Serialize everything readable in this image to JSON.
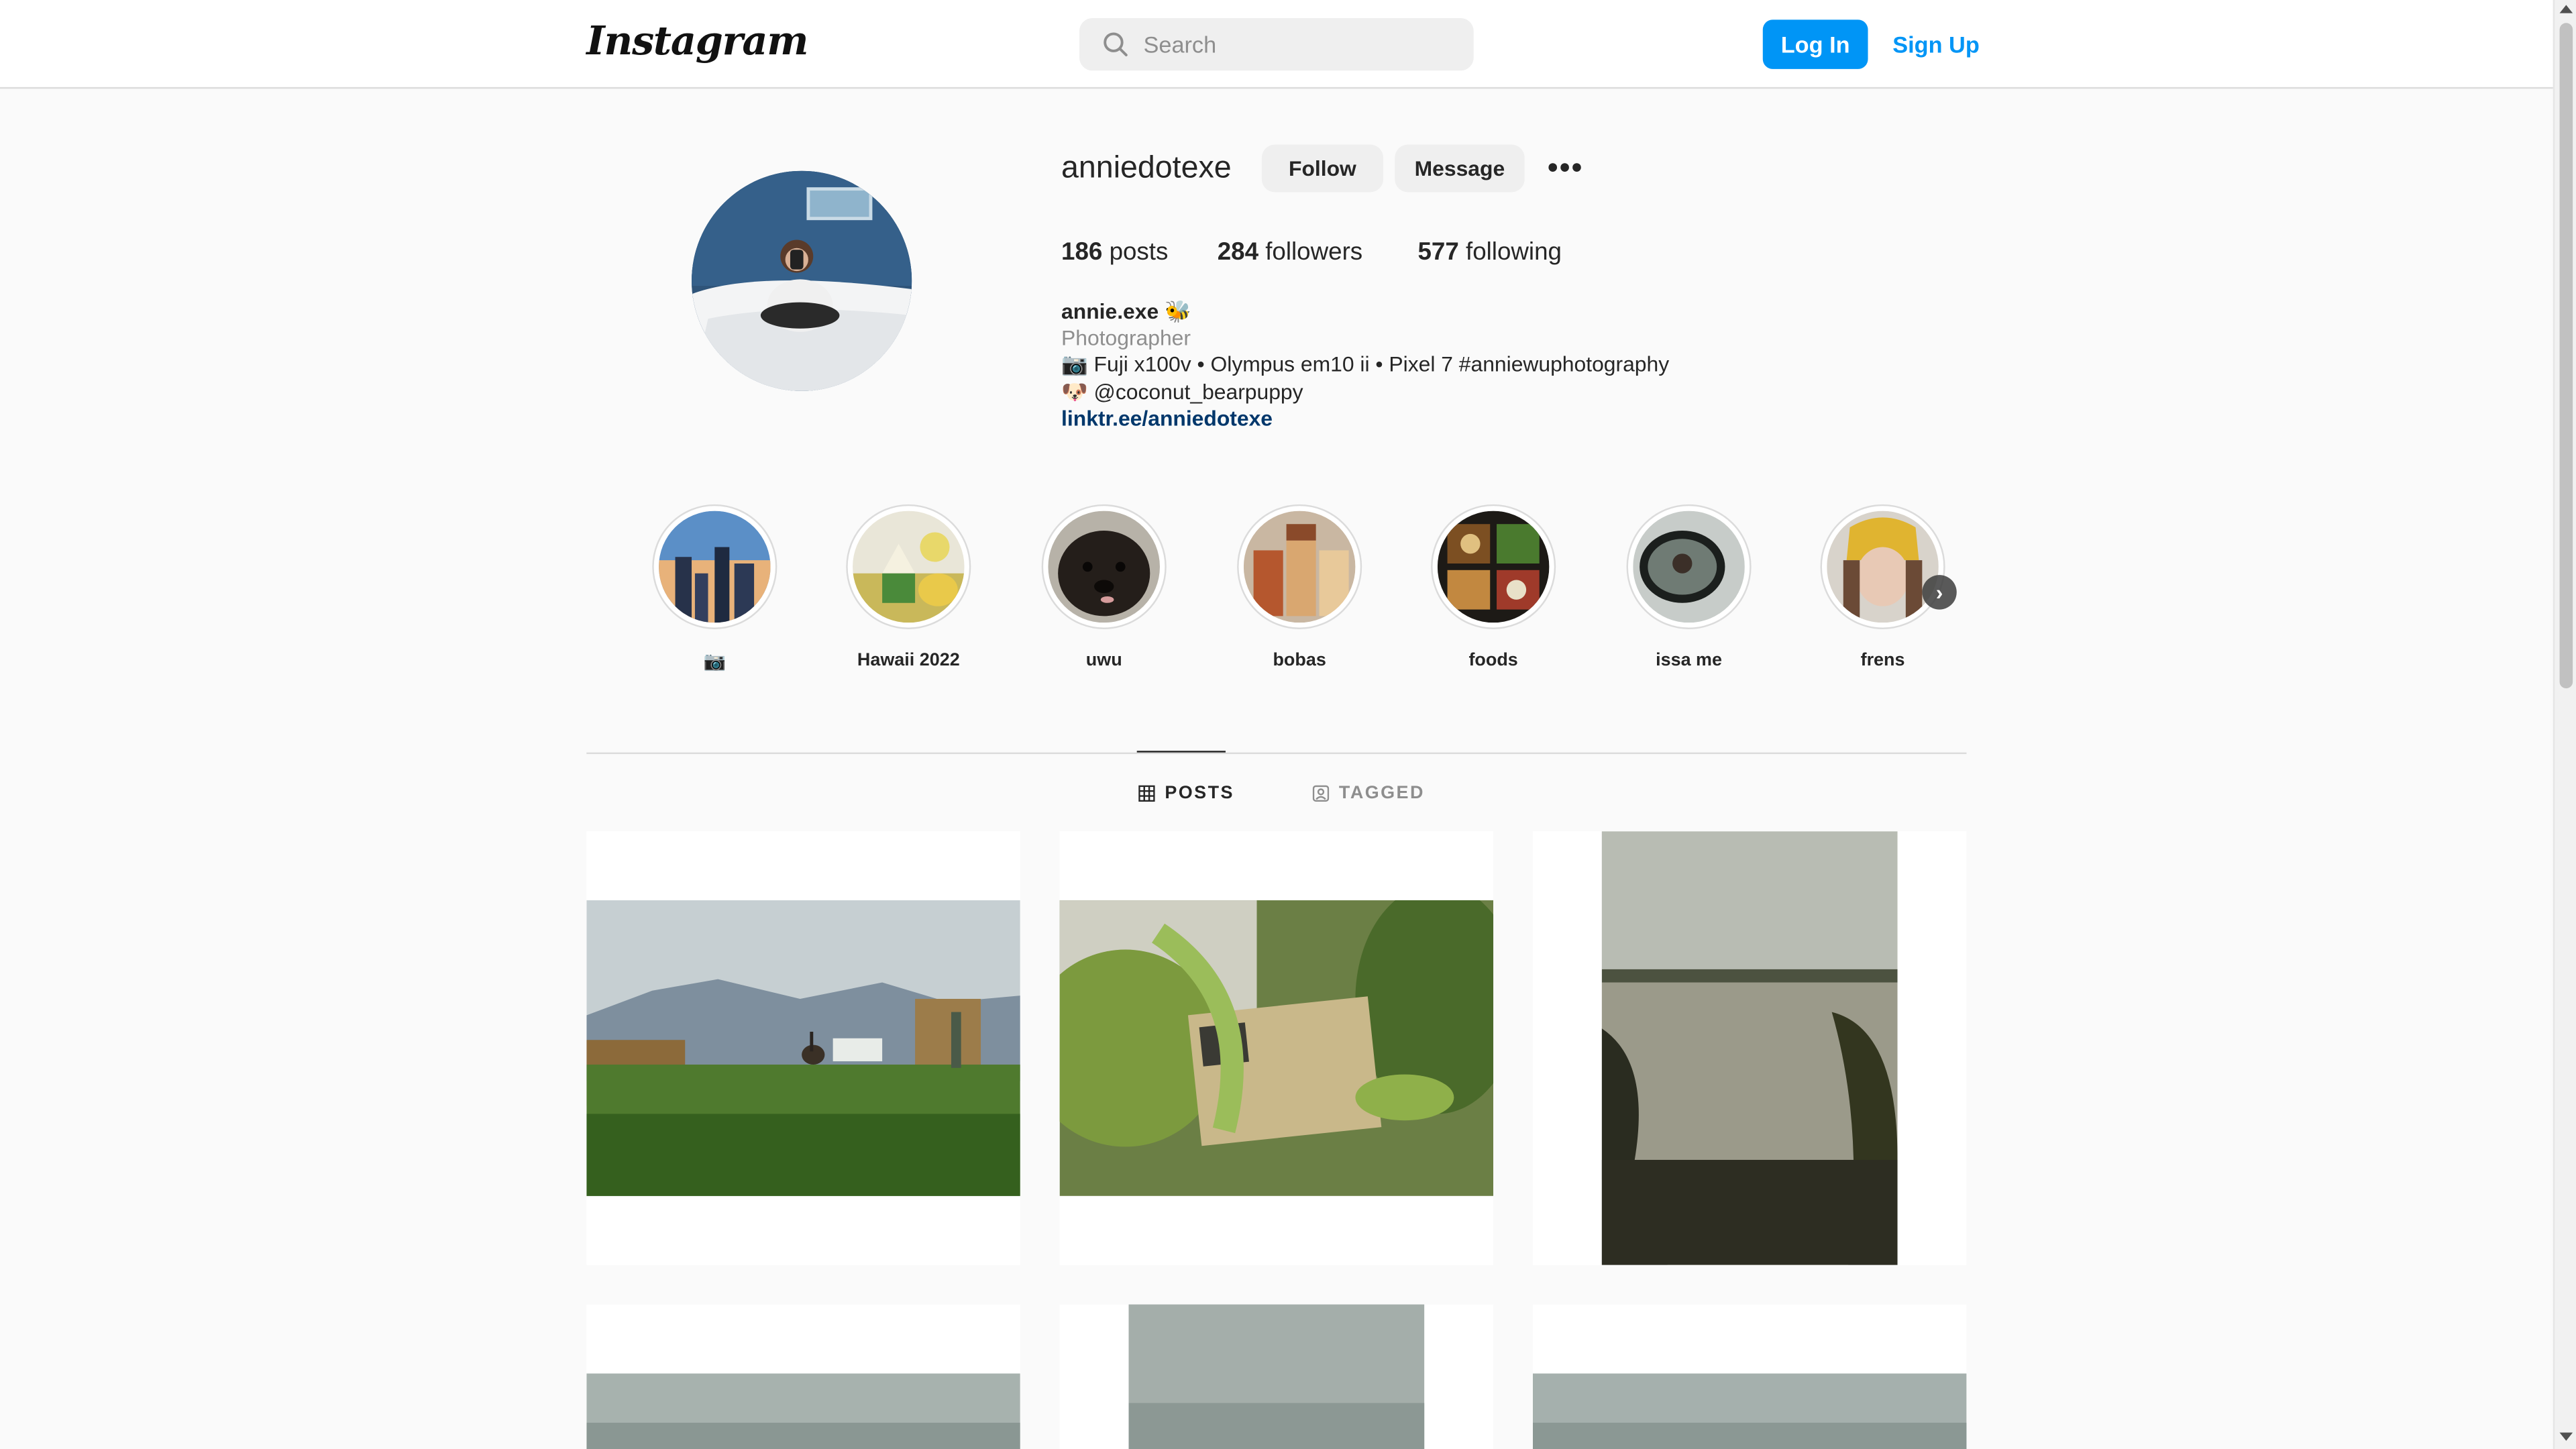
{
  "header": {
    "logo_text": "Instagram",
    "search_placeholder": "Search",
    "login_label": "Log In",
    "signup_label": "Sign Up"
  },
  "profile": {
    "username": "anniedotexe",
    "follow_label": "Follow",
    "message_label": "Message",
    "more_label": "•••",
    "stats": {
      "posts_count": "186",
      "posts_label": "posts",
      "followers_count": "284",
      "followers_label": "followers",
      "following_count": "577",
      "following_label": "following"
    },
    "bio": {
      "display_name": "annie.exe 🐝",
      "category": "Photographer",
      "line1": "📷 Fuji x100v • Olympus em10 ii • Pixel 7 #anniewuphotography",
      "line2": "🐶 @coconut_bearpuppy",
      "link": "linktr.ee/anniedotexe"
    }
  },
  "highlights": [
    {
      "label": "📷"
    },
    {
      "label": "Hawaii 2022"
    },
    {
      "label": "uwu"
    },
    {
      "label": "bobas"
    },
    {
      "label": "foods"
    },
    {
      "label": "issa me"
    },
    {
      "label": "frens"
    }
  ],
  "tabs": {
    "posts_label": "POSTS",
    "tagged_label": "TAGGED"
  },
  "colors": {
    "accent": "#0095f6",
    "link": "#00376b",
    "background": "#fafafa",
    "border": "#dbdbdb"
  }
}
